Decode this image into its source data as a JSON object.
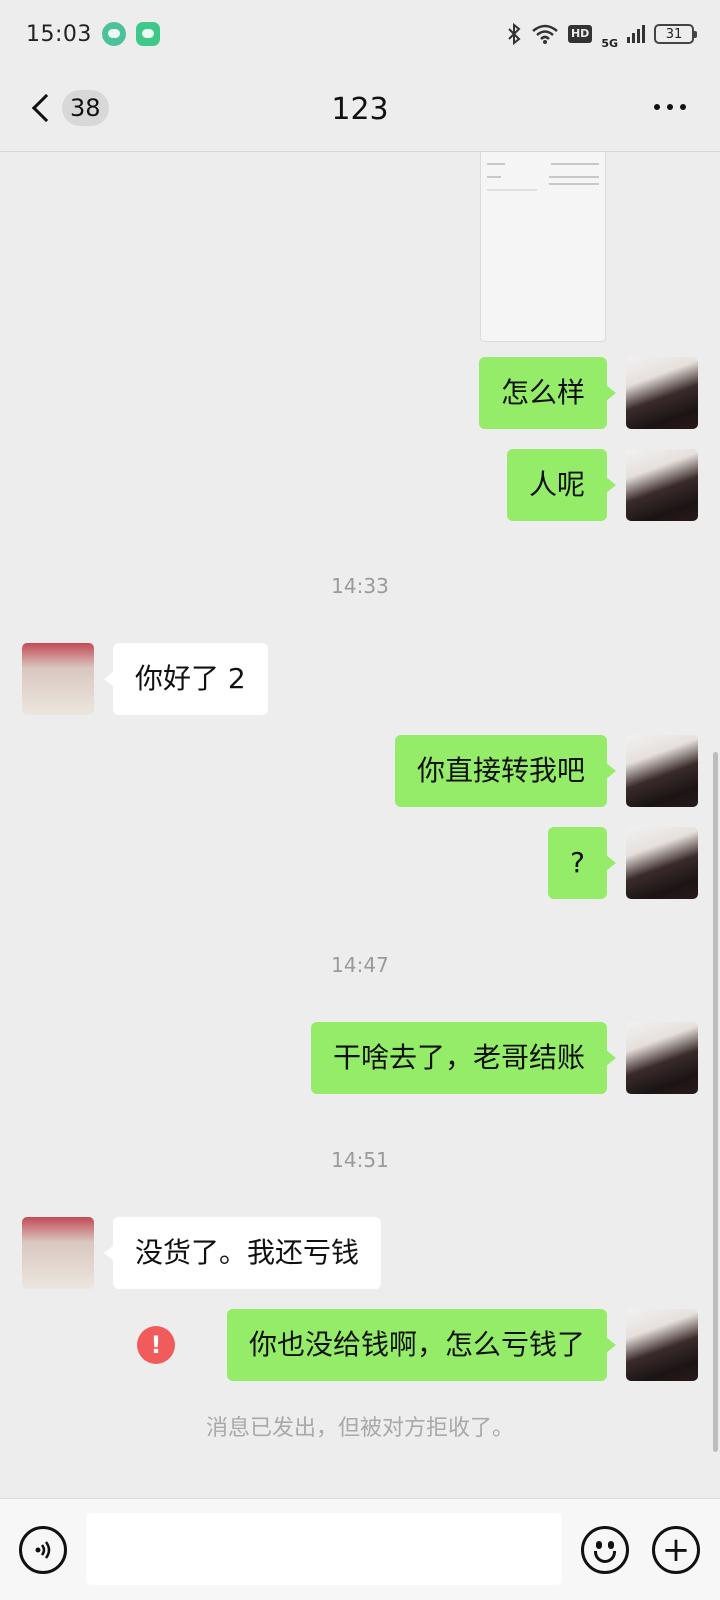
{
  "status_bar": {
    "time": "15:03",
    "hd": "HD",
    "network": "5G",
    "battery": "31"
  },
  "nav": {
    "unread_count": "38",
    "title": "123"
  },
  "messages": [
    {
      "from": "me",
      "text": "怎么样"
    },
    {
      "from": "me",
      "text": "人呢"
    },
    {
      "type": "time",
      "text": "14:33"
    },
    {
      "from": "them",
      "text": "你好了 2"
    },
    {
      "from": "me",
      "text": "你直接转我吧"
    },
    {
      "from": "me",
      "text": "?"
    },
    {
      "type": "time",
      "text": "14:47"
    },
    {
      "from": "me",
      "text": "干啥去了，老哥结账"
    },
    {
      "type": "time",
      "text": "14:51"
    },
    {
      "from": "them",
      "text": "没货了。我还亏钱"
    },
    {
      "from": "me",
      "text": "你也没给钱啊，怎么亏钱了",
      "failed": true
    }
  ],
  "error_icon": "!",
  "system_notice": "消息已发出，但被对方拒收了。",
  "input": {
    "placeholder": ""
  },
  "icons": {
    "plus": "+"
  }
}
